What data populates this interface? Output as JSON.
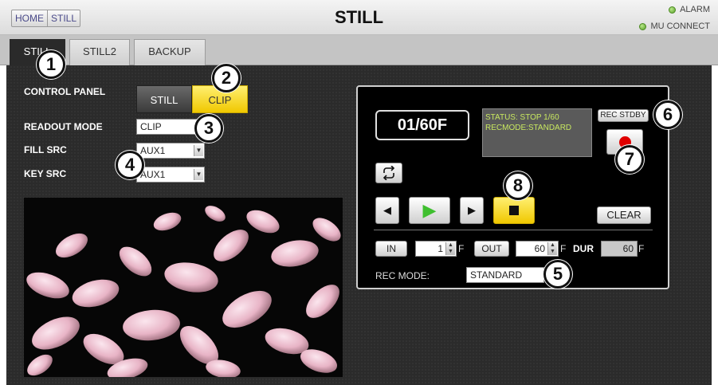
{
  "header": {
    "breadcrumbs": [
      "HOME",
      "STILL"
    ],
    "title": "STILL",
    "indicators": [
      {
        "label": "ALARM",
        "color": "#6abf3a"
      },
      {
        "label": "MU CONNECT",
        "color": "#6abf3a"
      }
    ]
  },
  "tabs": [
    {
      "label": "STILL",
      "active": true
    },
    {
      "label": "STILL2",
      "active": false
    },
    {
      "label": "BACKUP",
      "active": false
    }
  ],
  "left": {
    "control_panel_label": "CONTROL PANEL",
    "control_panel_options": [
      "STILL",
      "CLIP"
    ],
    "control_panel_selected": "CLIP",
    "readout_mode_label": "READOUT MODE",
    "readout_mode_value": "CLIP",
    "fill_src_label": "FILL SRC",
    "fill_src_value": "AUX1",
    "key_src_label": "KEY SRC",
    "key_src_value": "AUX1"
  },
  "clip_panel": {
    "frame_counter": "01/60F",
    "status_line1": "STATUS: STOP 1/60",
    "status_line2": "RECMODE:STANDARD",
    "rec_stdby_label": "REC STDBY",
    "clear_label": "CLEAR",
    "in_label": "IN",
    "in_value": "1",
    "in_unit": "F",
    "out_label": "OUT",
    "out_value": "60",
    "out_unit": "F",
    "dur_label": "DUR",
    "dur_value": "60",
    "dur_unit": "F",
    "rec_mode_label": "REC MODE:",
    "rec_mode_value": "STANDARD"
  },
  "callouts": [
    "1",
    "2",
    "3",
    "4",
    "5",
    "6",
    "7",
    "8"
  ],
  "colors": {
    "accent_yellow": "#f5d800",
    "play_green": "#3fbf2f",
    "record_red": "#e00000",
    "status_text": "#c8e860"
  }
}
